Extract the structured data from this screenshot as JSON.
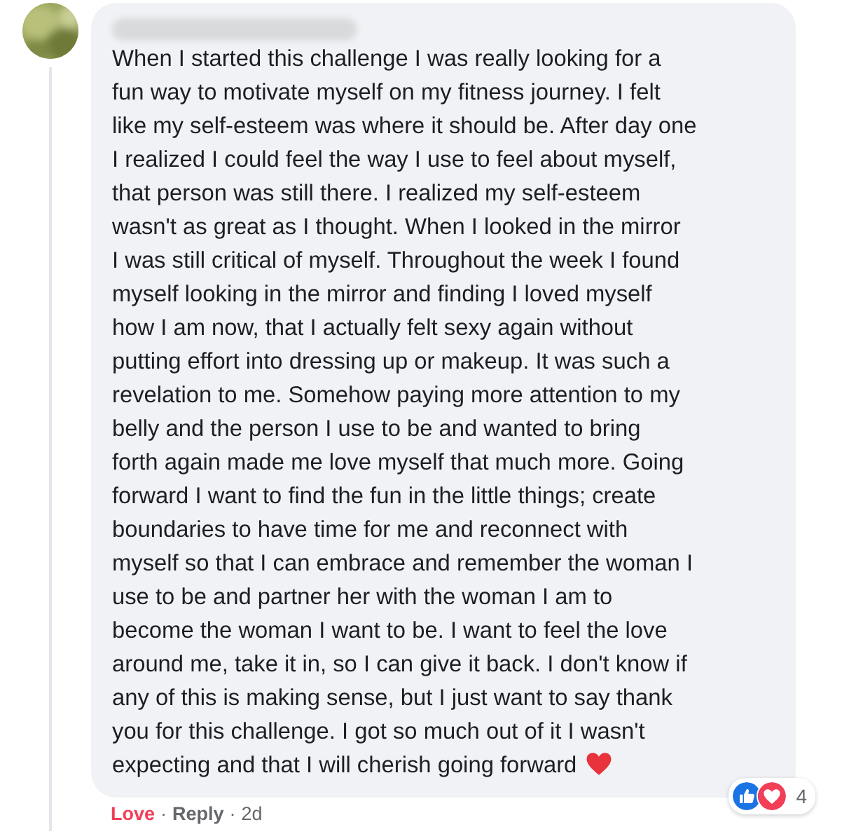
{
  "comment": {
    "author_hidden": true,
    "lines": [
      "When I started this challenge I was really looking for a",
      "fun way to motivate myself on my fitness journey. I felt",
      "like my self-esteem was where it should be. After day one",
      "I realized I could feel the way I use to feel about myself,",
      "that person was still there. I realized my self-esteem",
      "wasn't as great as I thought. When I looked in the mirror",
      "I was still critical of myself. Throughout the week I found",
      "myself looking in the mirror and finding I loved myself",
      "how I am now, that I actually felt sexy again without",
      "putting effort into dressing up or makeup. It was such a",
      "revelation to me. Somehow paying more attention to my",
      "belly and the person I use to be and wanted to bring",
      "forth again made me love myself that much more. Going",
      "forward I want to find the fun in the little things; create",
      "boundaries to have time for me and reconnect with",
      "myself so that I can embrace and remember the woman I",
      "use to be and partner her with the woman I am to",
      "become the woman I want to be. I want to feel the love",
      "around me, take it in, so I can give it back. I don't know if",
      "any of this is making sense, but I just want to say thank",
      "you for this challenge. I got so much out of it I wasn't",
      "expecting and that I will cherish going forward"
    ],
    "reaction_count": "4"
  },
  "separator": "·",
  "actions": [
    {
      "kind": "reaction",
      "label": "Love",
      "reacted": true
    },
    {
      "kind": "link",
      "label": "Reply"
    },
    {
      "kind": "time",
      "label": "2d"
    }
  ]
}
